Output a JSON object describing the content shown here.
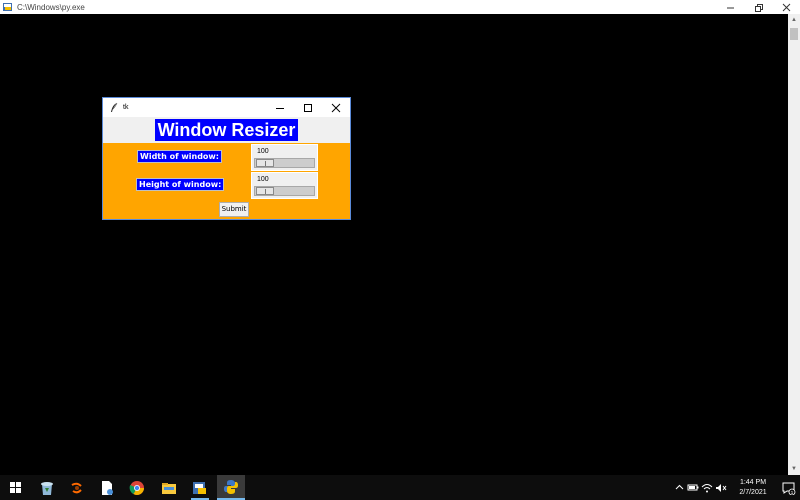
{
  "console": {
    "title": "C:\\Windows\\py.exe",
    "controls": [
      "minimize",
      "restore",
      "close"
    ]
  },
  "tk_window": {
    "title": "tk",
    "heading": "Window Resizer",
    "width_label": "Width of window:",
    "height_label": "Height of window:",
    "width_value": "100",
    "height_value": "100",
    "width_slider_fraction": 0.0,
    "height_slider_fraction": 0.0,
    "submit_label": "Submit",
    "heading_bg": "#0000ff",
    "body_bg": "#ffa500"
  },
  "taskbar": {
    "apps": [
      "recycle-bin-icon",
      "firefox-dev-icon",
      "file-document-icon",
      "chrome-icon",
      "file-explorer-icon",
      "python-idle-icon",
      "python-launcher-icon"
    ],
    "active_app": "python-launcher-icon",
    "tray_icons": [
      "chevron-up-icon",
      "battery-icon",
      "wifi-icon",
      "volume-icon"
    ],
    "time": "1:44 PM",
    "date": "2/7/2021",
    "notification_count": "1"
  }
}
